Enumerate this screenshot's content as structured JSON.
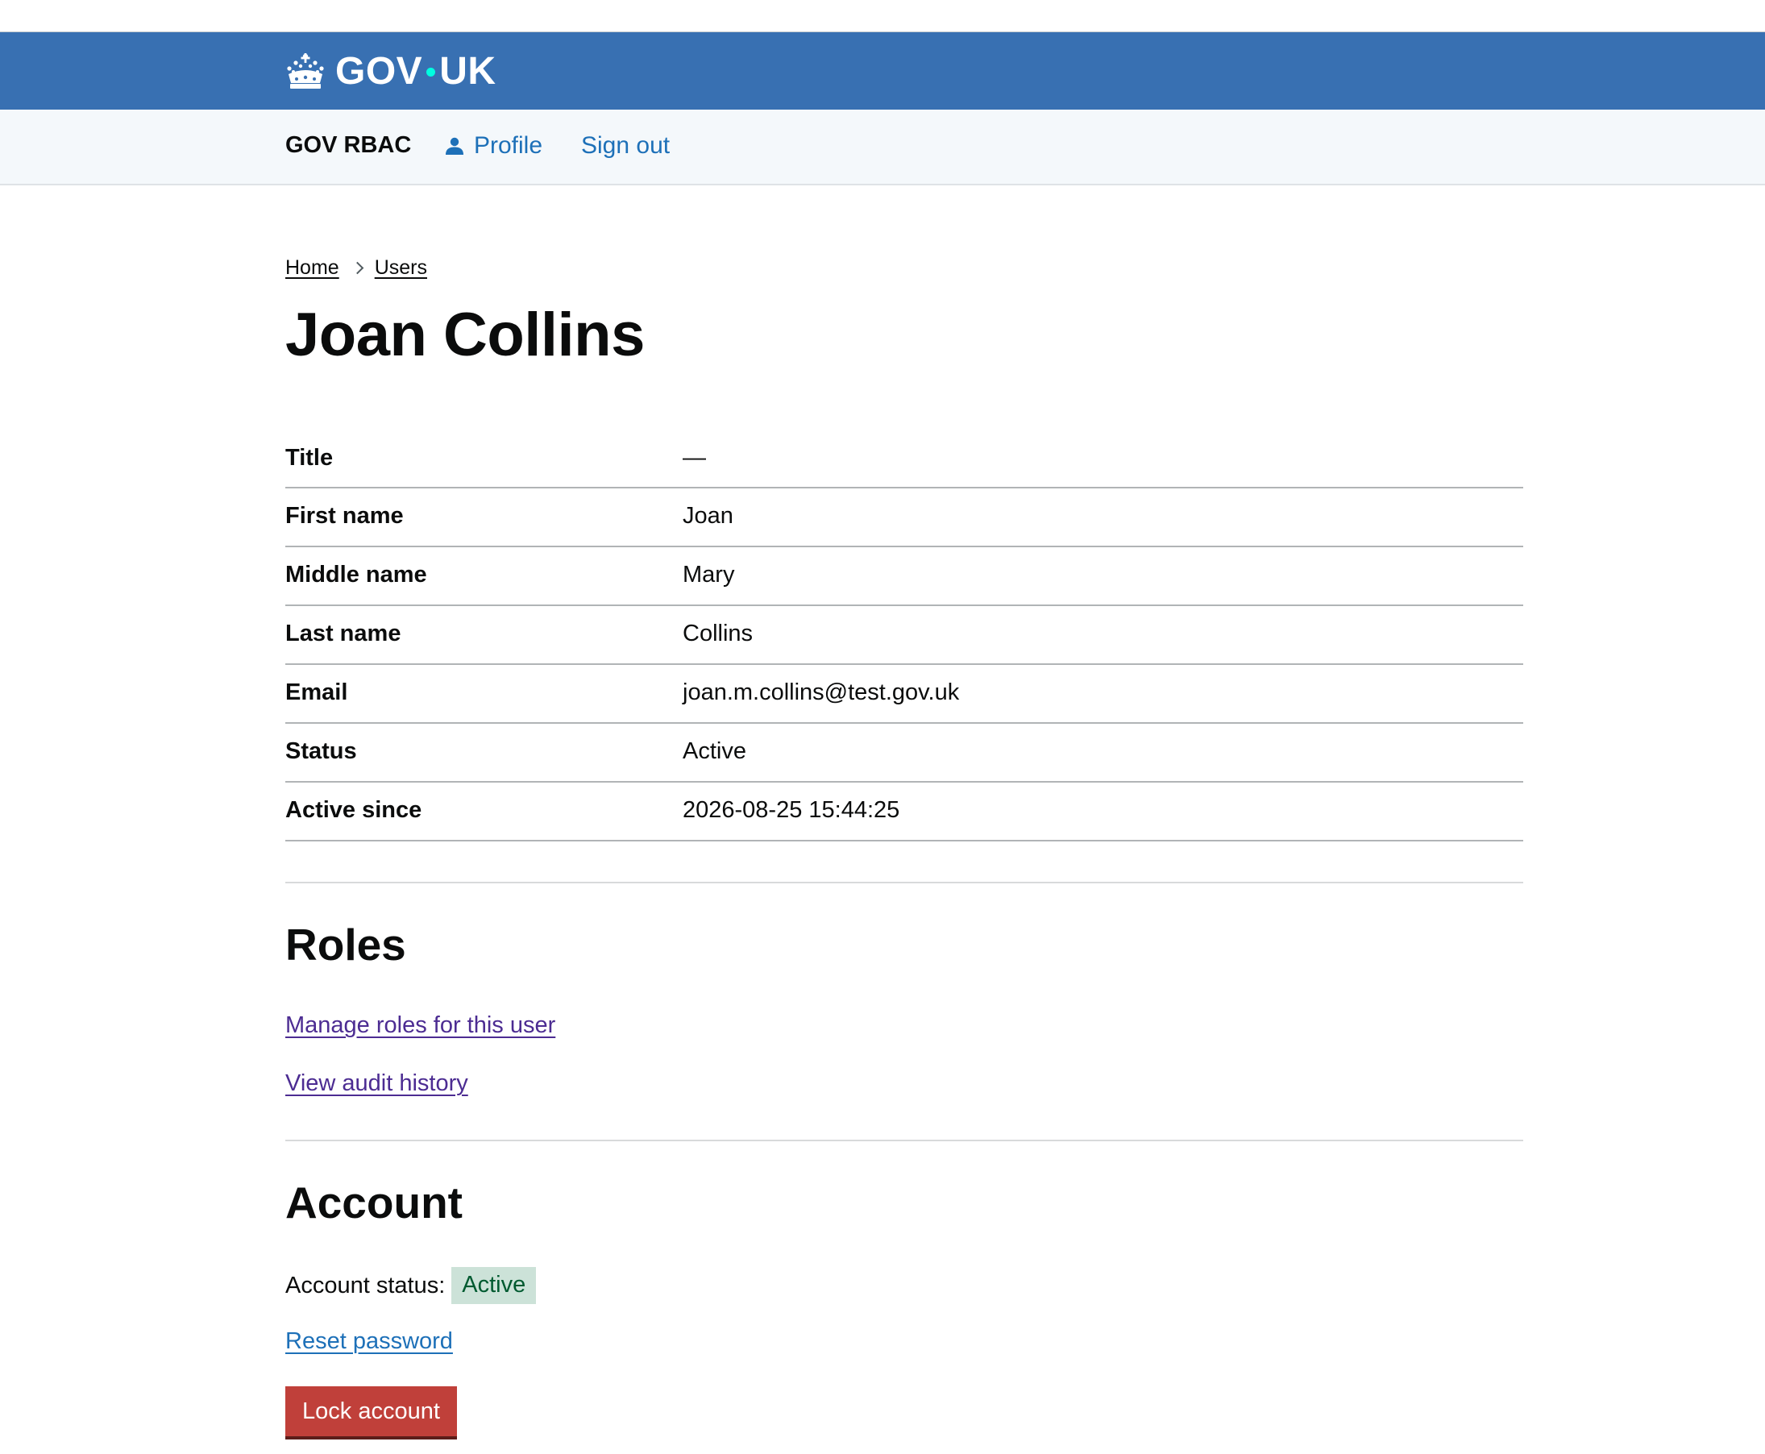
{
  "header": {
    "logo_text_left": "GOV",
    "logo_text_right": "UK",
    "logo_icon": "crown-icon",
    "brand_color": "#3870b2",
    "dot_color": "#00ffe0"
  },
  "service_nav": {
    "service_name": "GOV RBAC",
    "profile_label": "Profile",
    "profile_icon": "person-icon",
    "signout_label": "Sign out",
    "link_color": "#1d70b8"
  },
  "breadcrumbs": {
    "items": [
      {
        "label": "Home"
      },
      {
        "label": "Users"
      }
    ]
  },
  "page": {
    "title": "Joan Collins"
  },
  "summary": {
    "rows": [
      {
        "key": "Title",
        "value": "—"
      },
      {
        "key": "First name",
        "value": "Joan"
      },
      {
        "key": "Middle name",
        "value": "Mary"
      },
      {
        "key": "Last name",
        "value": "Collins"
      },
      {
        "key": "Email",
        "value": "joan.m.collins@test.gov.uk"
      },
      {
        "key": "Status",
        "value": "Active"
      },
      {
        "key": "Active since",
        "value": "2026-08-25 15:44:25"
      }
    ]
  },
  "roles": {
    "heading": "Roles",
    "manage_link": "Manage roles for this user",
    "audit_link": "View audit history"
  },
  "account": {
    "heading": "Account",
    "status_label": "Account status:",
    "status_tag": "Active",
    "status_tag_color": "#cce2d8",
    "reset_link": "Reset password",
    "lock_button": "Lock account",
    "lock_button_color": "#c0403a"
  }
}
